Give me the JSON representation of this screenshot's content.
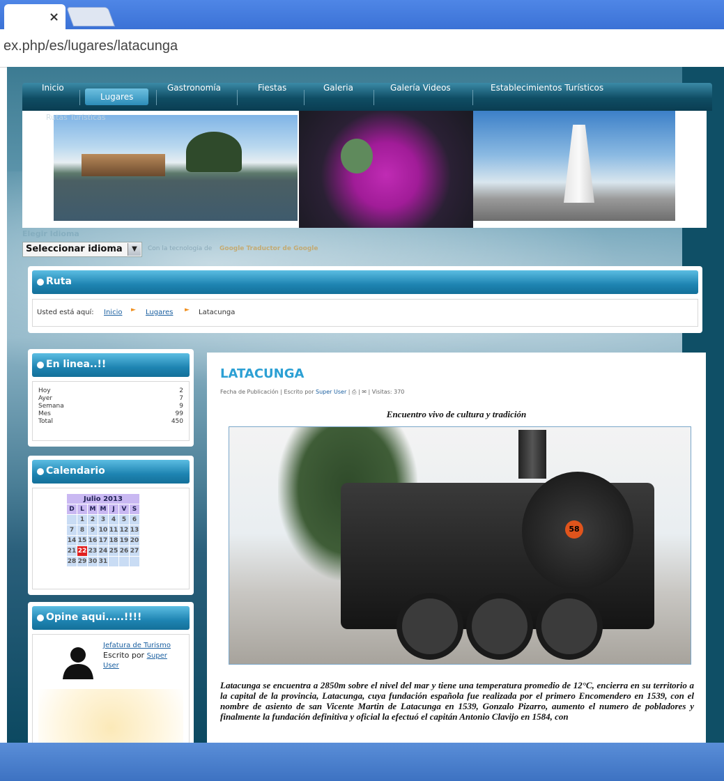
{
  "browser": {
    "tab_close": "×",
    "url": "ex.php/es/lugares/latacunga"
  },
  "nav": {
    "items": [
      {
        "label": "Inicio"
      },
      {
        "label": "Lugares"
      },
      {
        "label": "Gastronomía"
      },
      {
        "label": "Fiestas"
      },
      {
        "label": "Galeria"
      },
      {
        "label": "Galería Videos"
      },
      {
        "label": "Establecimientos Turísticos"
      }
    ],
    "sub": "Rutas Turísticas",
    "active": "Lugares"
  },
  "language": {
    "title": "Elegir Idioma",
    "select_value": "Seleccionar idioma",
    "powered": "Con la tecnología de",
    "google": "Google Traductor de Google"
  },
  "ruta": {
    "title": "Ruta",
    "prefix": "Usted está aquí:",
    "crumbs": [
      "Inicio",
      "Lugares",
      "Latacunga"
    ]
  },
  "online": {
    "title": "En linea..!!",
    "rows": [
      {
        "label": "Hoy",
        "value": "2"
      },
      {
        "label": "Ayer",
        "value": "7"
      },
      {
        "label": "Semana",
        "value": "9"
      },
      {
        "label": "Mes",
        "value": "99"
      },
      {
        "label": "Total",
        "value": "450"
      }
    ]
  },
  "calendar": {
    "title": "Calendario",
    "month": "Julio 2013",
    "days": [
      "D",
      "L",
      "M",
      "M",
      "J",
      "V",
      "S"
    ],
    "weeks": [
      [
        "",
        "1",
        "2",
        "3",
        "4",
        "5",
        "6"
      ],
      [
        "7",
        "8",
        "9",
        "10",
        "11",
        "12",
        "13"
      ],
      [
        "14",
        "15",
        "16",
        "17",
        "18",
        "19",
        "20"
      ],
      [
        "21",
        "22",
        "23",
        "24",
        "25",
        "26",
        "27"
      ],
      [
        "28",
        "29",
        "30",
        "31",
        "",
        "",
        ""
      ]
    ],
    "today": "22"
  },
  "opine": {
    "title": "Opine aqui.....!!!!",
    "link": "Jefatura de Turismo",
    "by_prefix": "Escrito por",
    "by_user": "Super User"
  },
  "article": {
    "title": "LATACUNGA",
    "meta_date": "Fecha de Publicación",
    "meta_by": "Escrito por",
    "meta_author": "Super User",
    "meta_visits": "Visitas: 370",
    "subtitle": "Encuentro vivo de cultura y tradición",
    "photo_badge": "58",
    "body": "Latacunga se encuentra a 2850m sobre el nivel del mar y tiene una temperatura promedio de 12°C, encierra en su territorio a la capital de la provincia, Latacunga, cuya fundación española fue realizada por el primero Encomendero en 1539, con el nombre de asiento de san Vicente Martin de Latacunga en 1539, Gonzalo Pizarro, aumento el numero de pobladores y finalmente la fundación definitiva y oficial la efectuó el capitán Antonio Clavijo en 1584, con"
  },
  "colors": {
    "nav_dark": "#0f4d64",
    "header_blue": "#1e84b2",
    "title_blue": "#2ca0d4",
    "today_red": "#e02020"
  }
}
